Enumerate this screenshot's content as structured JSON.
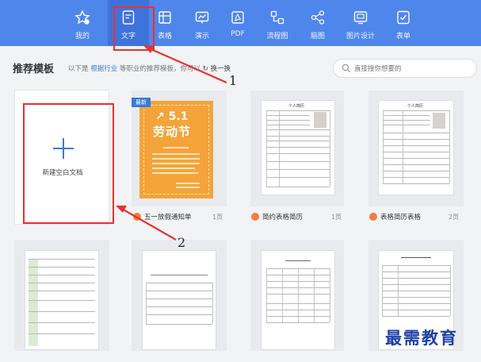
{
  "toolbar": {
    "items": [
      {
        "label": "我的",
        "icon": "star-badge-icon"
      },
      {
        "label": "文字",
        "icon": "document-icon"
      },
      {
        "label": "表格",
        "icon": "table-icon"
      },
      {
        "label": "演示",
        "icon": "presentation-icon"
      },
      {
        "label": "PDF",
        "icon": "pdf-icon"
      },
      {
        "label": "流程图",
        "icon": "flowchart-icon"
      },
      {
        "label": "脑图",
        "icon": "mindmap-icon"
      },
      {
        "label": "图片设计",
        "icon": "image-design-icon"
      },
      {
        "label": "表单",
        "icon": "form-icon"
      }
    ],
    "active": "文字",
    "bg_color": "#4f86ec"
  },
  "header": {
    "title": "推荐模板",
    "desc_prefix": "以下是",
    "desc_link": "根据行业",
    "desc_suffix": "等职业的推荐模板，你可以",
    "swap_label": "换一换",
    "search_placeholder": "直接搜你想要的"
  },
  "blank_card": {
    "label": "新建空白文档"
  },
  "templates": [
    {
      "title": "五一放假通知单",
      "pages": "1页",
      "badge": "最新",
      "poster_line1": "5.1",
      "poster_line2": "劳动节"
    },
    {
      "title": "简约表格简历",
      "pages": "1页",
      "heading": "个人简历"
    },
    {
      "title": "表格简历表格",
      "pages": "2页",
      "heading": "个人简历"
    }
  ],
  "annotations": {
    "step1": "1",
    "step2": "2",
    "color": "#e8312f"
  },
  "watermark": "最需教育"
}
